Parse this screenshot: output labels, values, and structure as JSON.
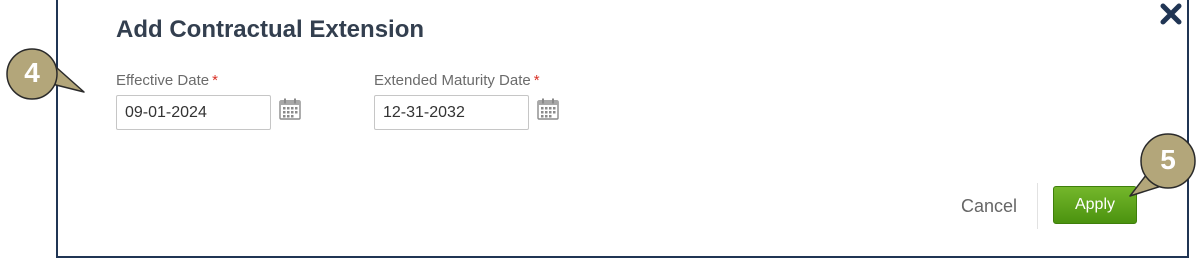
{
  "dialog": {
    "title": "Add Contractual Extension",
    "close_icon": "close-icon",
    "fields": {
      "effective_date": {
        "label": "Effective Date",
        "required_mark": "*",
        "value": "09-01-2024",
        "icon": "calendar-icon"
      },
      "extended_maturity_date": {
        "label": "Extended Maturity Date",
        "required_mark": "*",
        "value": "12-31-2032",
        "icon": "calendar-icon"
      }
    },
    "actions": {
      "cancel_label": "Cancel",
      "apply_label": "Apply"
    }
  },
  "callouts": [
    {
      "number": "4"
    },
    {
      "number": "5"
    }
  ],
  "colors": {
    "border": "#203554",
    "title": "#333f4f",
    "required": "#d93025",
    "apply_button": "#5ca31c",
    "callout_fill": "#b3a67a"
  }
}
